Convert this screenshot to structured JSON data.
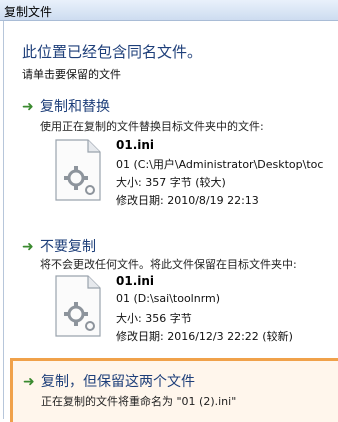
{
  "window": {
    "title": "复制文件"
  },
  "heading": "此位置已经包含同名文件。",
  "subheading": "请单击要保留的文件",
  "options": [
    {
      "arrow": "➜",
      "title": "复制和替换",
      "description": "使用正在复制的文件替换目标文件夹中的文件:",
      "file": {
        "name": "01.ini",
        "path": "01 (C:\\用户\\Administrator\\Desktop\\toc",
        "size": "大小: 357 字节 (较大)",
        "modified": "修改日期: 2010/8/19 22:13"
      }
    },
    {
      "arrow": "➜",
      "title": "不要复制",
      "description": "将不会更改任何文件。将此文件保留在目标文件夹中:",
      "file": {
        "name": "01.ini",
        "path": "01 (D:\\sai\\toolnrm)",
        "size": "大小: 356 字节",
        "modified": "修改日期: 2016/12/3 22:22 (较新)"
      }
    },
    {
      "arrow": "➜",
      "title": "复制，但保留这两个文件",
      "description": "正在复制的文件将重命名为 \"01 (2).ini\""
    }
  ],
  "colors": {
    "heading": "#1e3f7a",
    "arrow": "#3a8a2f",
    "selected_border": "#f0a14a"
  }
}
